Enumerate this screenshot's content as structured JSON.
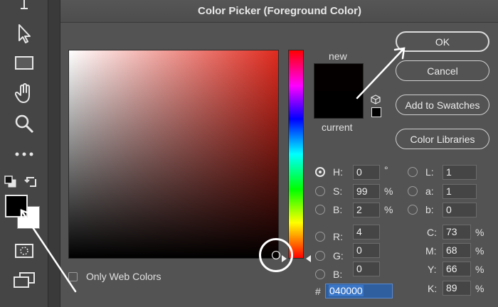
{
  "dialog": {
    "title": "Color Picker (Foreground Color)",
    "new_label": "new",
    "current_label": "current",
    "new_color": "#040000",
    "current_color": "#000000",
    "only_web_colors_label": "Only Web Colors"
  },
  "buttons": {
    "ok": "OK",
    "cancel": "Cancel",
    "add_to_swatches": "Add to Swatches",
    "color_libraries": "Color Libraries"
  },
  "hsb": {
    "h_label": "H:",
    "h_value": "0",
    "h_unit": "°",
    "s_label": "S:",
    "s_value": "99",
    "s_unit": "%",
    "b_label": "B:",
    "b_value": "2",
    "b_unit": "%"
  },
  "rgb": {
    "r_label": "R:",
    "r_value": "4",
    "g_label": "G:",
    "g_value": "0",
    "b_label": "B:",
    "b_value": "0"
  },
  "lab": {
    "l_label": "L:",
    "l_value": "1",
    "a_label": "a:",
    "a_value": "1",
    "b_label": "b:",
    "b_value": "0"
  },
  "cmyk": {
    "c_label": "C:",
    "c_value": "73",
    "c_unit": "%",
    "m_label": "M:",
    "m_value": "68",
    "m_unit": "%",
    "y_label": "Y:",
    "y_value": "66",
    "y_unit": "%",
    "k_label": "K:",
    "k_value": "89",
    "k_unit": "%"
  },
  "hex": {
    "label": "#",
    "value": "040000"
  },
  "tools": {
    "icons": [
      "type-tool-icon",
      "move-tool-icon",
      "rectangle-tool-icon",
      "hand-tool-icon",
      "zoom-tool-icon",
      "more-tools-icon",
      "default-colors-icon",
      "swap-colors-icon",
      "quick-mask-icon",
      "screen-mode-icon"
    ],
    "foreground_color": "#000000",
    "background_color": "#ffffff"
  },
  "colors": {
    "dialog_bg": "#535353",
    "panel_bg": "#454545",
    "hex_highlight": "#3a76c8"
  }
}
